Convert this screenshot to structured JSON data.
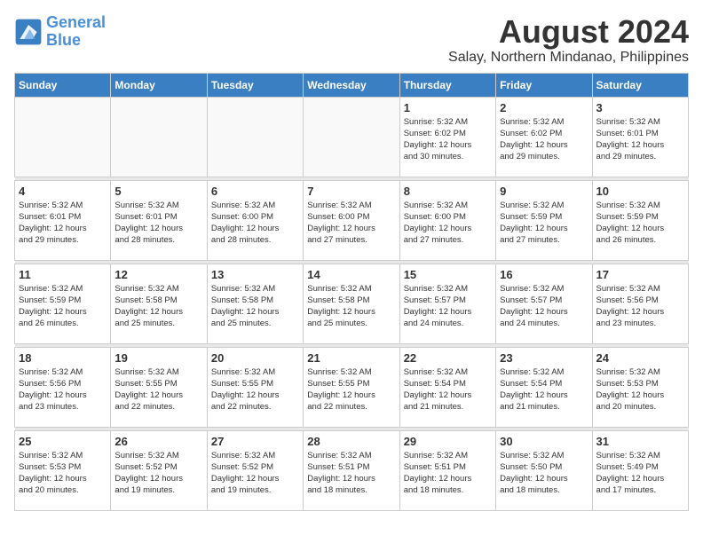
{
  "header": {
    "logo_line1": "General",
    "logo_line2": "Blue",
    "month_year": "August 2024",
    "location": "Salay, Northern Mindanao, Philippines"
  },
  "weekdays": [
    "Sunday",
    "Monday",
    "Tuesday",
    "Wednesday",
    "Thursday",
    "Friday",
    "Saturday"
  ],
  "weeks": [
    [
      {
        "day": "",
        "info": ""
      },
      {
        "day": "",
        "info": ""
      },
      {
        "day": "",
        "info": ""
      },
      {
        "day": "",
        "info": ""
      },
      {
        "day": "1",
        "info": "Sunrise: 5:32 AM\nSunset: 6:02 PM\nDaylight: 12 hours\nand 30 minutes."
      },
      {
        "day": "2",
        "info": "Sunrise: 5:32 AM\nSunset: 6:02 PM\nDaylight: 12 hours\nand 29 minutes."
      },
      {
        "day": "3",
        "info": "Sunrise: 5:32 AM\nSunset: 6:01 PM\nDaylight: 12 hours\nand 29 minutes."
      }
    ],
    [
      {
        "day": "4",
        "info": "Sunrise: 5:32 AM\nSunset: 6:01 PM\nDaylight: 12 hours\nand 29 minutes."
      },
      {
        "day": "5",
        "info": "Sunrise: 5:32 AM\nSunset: 6:01 PM\nDaylight: 12 hours\nand 28 minutes."
      },
      {
        "day": "6",
        "info": "Sunrise: 5:32 AM\nSunset: 6:00 PM\nDaylight: 12 hours\nand 28 minutes."
      },
      {
        "day": "7",
        "info": "Sunrise: 5:32 AM\nSunset: 6:00 PM\nDaylight: 12 hours\nand 27 minutes."
      },
      {
        "day": "8",
        "info": "Sunrise: 5:32 AM\nSunset: 6:00 PM\nDaylight: 12 hours\nand 27 minutes."
      },
      {
        "day": "9",
        "info": "Sunrise: 5:32 AM\nSunset: 5:59 PM\nDaylight: 12 hours\nand 27 minutes."
      },
      {
        "day": "10",
        "info": "Sunrise: 5:32 AM\nSunset: 5:59 PM\nDaylight: 12 hours\nand 26 minutes."
      }
    ],
    [
      {
        "day": "11",
        "info": "Sunrise: 5:32 AM\nSunset: 5:59 PM\nDaylight: 12 hours\nand 26 minutes."
      },
      {
        "day": "12",
        "info": "Sunrise: 5:32 AM\nSunset: 5:58 PM\nDaylight: 12 hours\nand 25 minutes."
      },
      {
        "day": "13",
        "info": "Sunrise: 5:32 AM\nSunset: 5:58 PM\nDaylight: 12 hours\nand 25 minutes."
      },
      {
        "day": "14",
        "info": "Sunrise: 5:32 AM\nSunset: 5:58 PM\nDaylight: 12 hours\nand 25 minutes."
      },
      {
        "day": "15",
        "info": "Sunrise: 5:32 AM\nSunset: 5:57 PM\nDaylight: 12 hours\nand 24 minutes."
      },
      {
        "day": "16",
        "info": "Sunrise: 5:32 AM\nSunset: 5:57 PM\nDaylight: 12 hours\nand 24 minutes."
      },
      {
        "day": "17",
        "info": "Sunrise: 5:32 AM\nSunset: 5:56 PM\nDaylight: 12 hours\nand 23 minutes."
      }
    ],
    [
      {
        "day": "18",
        "info": "Sunrise: 5:32 AM\nSunset: 5:56 PM\nDaylight: 12 hours\nand 23 minutes."
      },
      {
        "day": "19",
        "info": "Sunrise: 5:32 AM\nSunset: 5:55 PM\nDaylight: 12 hours\nand 22 minutes."
      },
      {
        "day": "20",
        "info": "Sunrise: 5:32 AM\nSunset: 5:55 PM\nDaylight: 12 hours\nand 22 minutes."
      },
      {
        "day": "21",
        "info": "Sunrise: 5:32 AM\nSunset: 5:55 PM\nDaylight: 12 hours\nand 22 minutes."
      },
      {
        "day": "22",
        "info": "Sunrise: 5:32 AM\nSunset: 5:54 PM\nDaylight: 12 hours\nand 21 minutes."
      },
      {
        "day": "23",
        "info": "Sunrise: 5:32 AM\nSunset: 5:54 PM\nDaylight: 12 hours\nand 21 minutes."
      },
      {
        "day": "24",
        "info": "Sunrise: 5:32 AM\nSunset: 5:53 PM\nDaylight: 12 hours\nand 20 minutes."
      }
    ],
    [
      {
        "day": "25",
        "info": "Sunrise: 5:32 AM\nSunset: 5:53 PM\nDaylight: 12 hours\nand 20 minutes."
      },
      {
        "day": "26",
        "info": "Sunrise: 5:32 AM\nSunset: 5:52 PM\nDaylight: 12 hours\nand 19 minutes."
      },
      {
        "day": "27",
        "info": "Sunrise: 5:32 AM\nSunset: 5:52 PM\nDaylight: 12 hours\nand 19 minutes."
      },
      {
        "day": "28",
        "info": "Sunrise: 5:32 AM\nSunset: 5:51 PM\nDaylight: 12 hours\nand 18 minutes."
      },
      {
        "day": "29",
        "info": "Sunrise: 5:32 AM\nSunset: 5:51 PM\nDaylight: 12 hours\nand 18 minutes."
      },
      {
        "day": "30",
        "info": "Sunrise: 5:32 AM\nSunset: 5:50 PM\nDaylight: 12 hours\nand 18 minutes."
      },
      {
        "day": "31",
        "info": "Sunrise: 5:32 AM\nSunset: 5:49 PM\nDaylight: 12 hours\nand 17 minutes."
      }
    ]
  ]
}
